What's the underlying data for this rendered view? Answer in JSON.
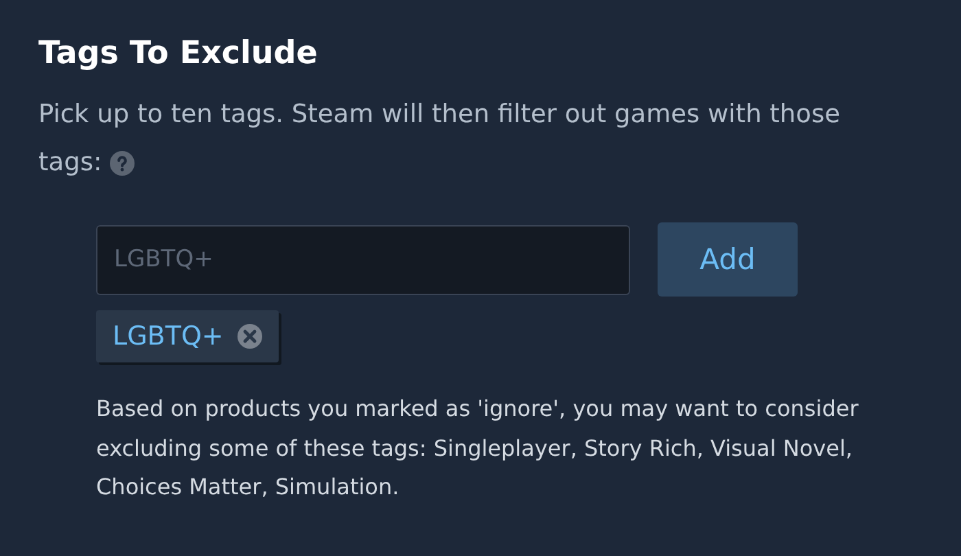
{
  "title": "Tags To Exclude",
  "description": "Pick up to ten tags. Steam will then filter out games with those tags:",
  "search": {
    "placeholder": "LGBTQ+"
  },
  "add_button": "Add",
  "tags": [
    {
      "label": "LGBTQ+"
    }
  ],
  "suggestion": "Based on products you marked as 'ignore', you may want to consider excluding some of these tags: Singleplayer, Story Rich, Visual Novel, Choices Matter, Simulation."
}
